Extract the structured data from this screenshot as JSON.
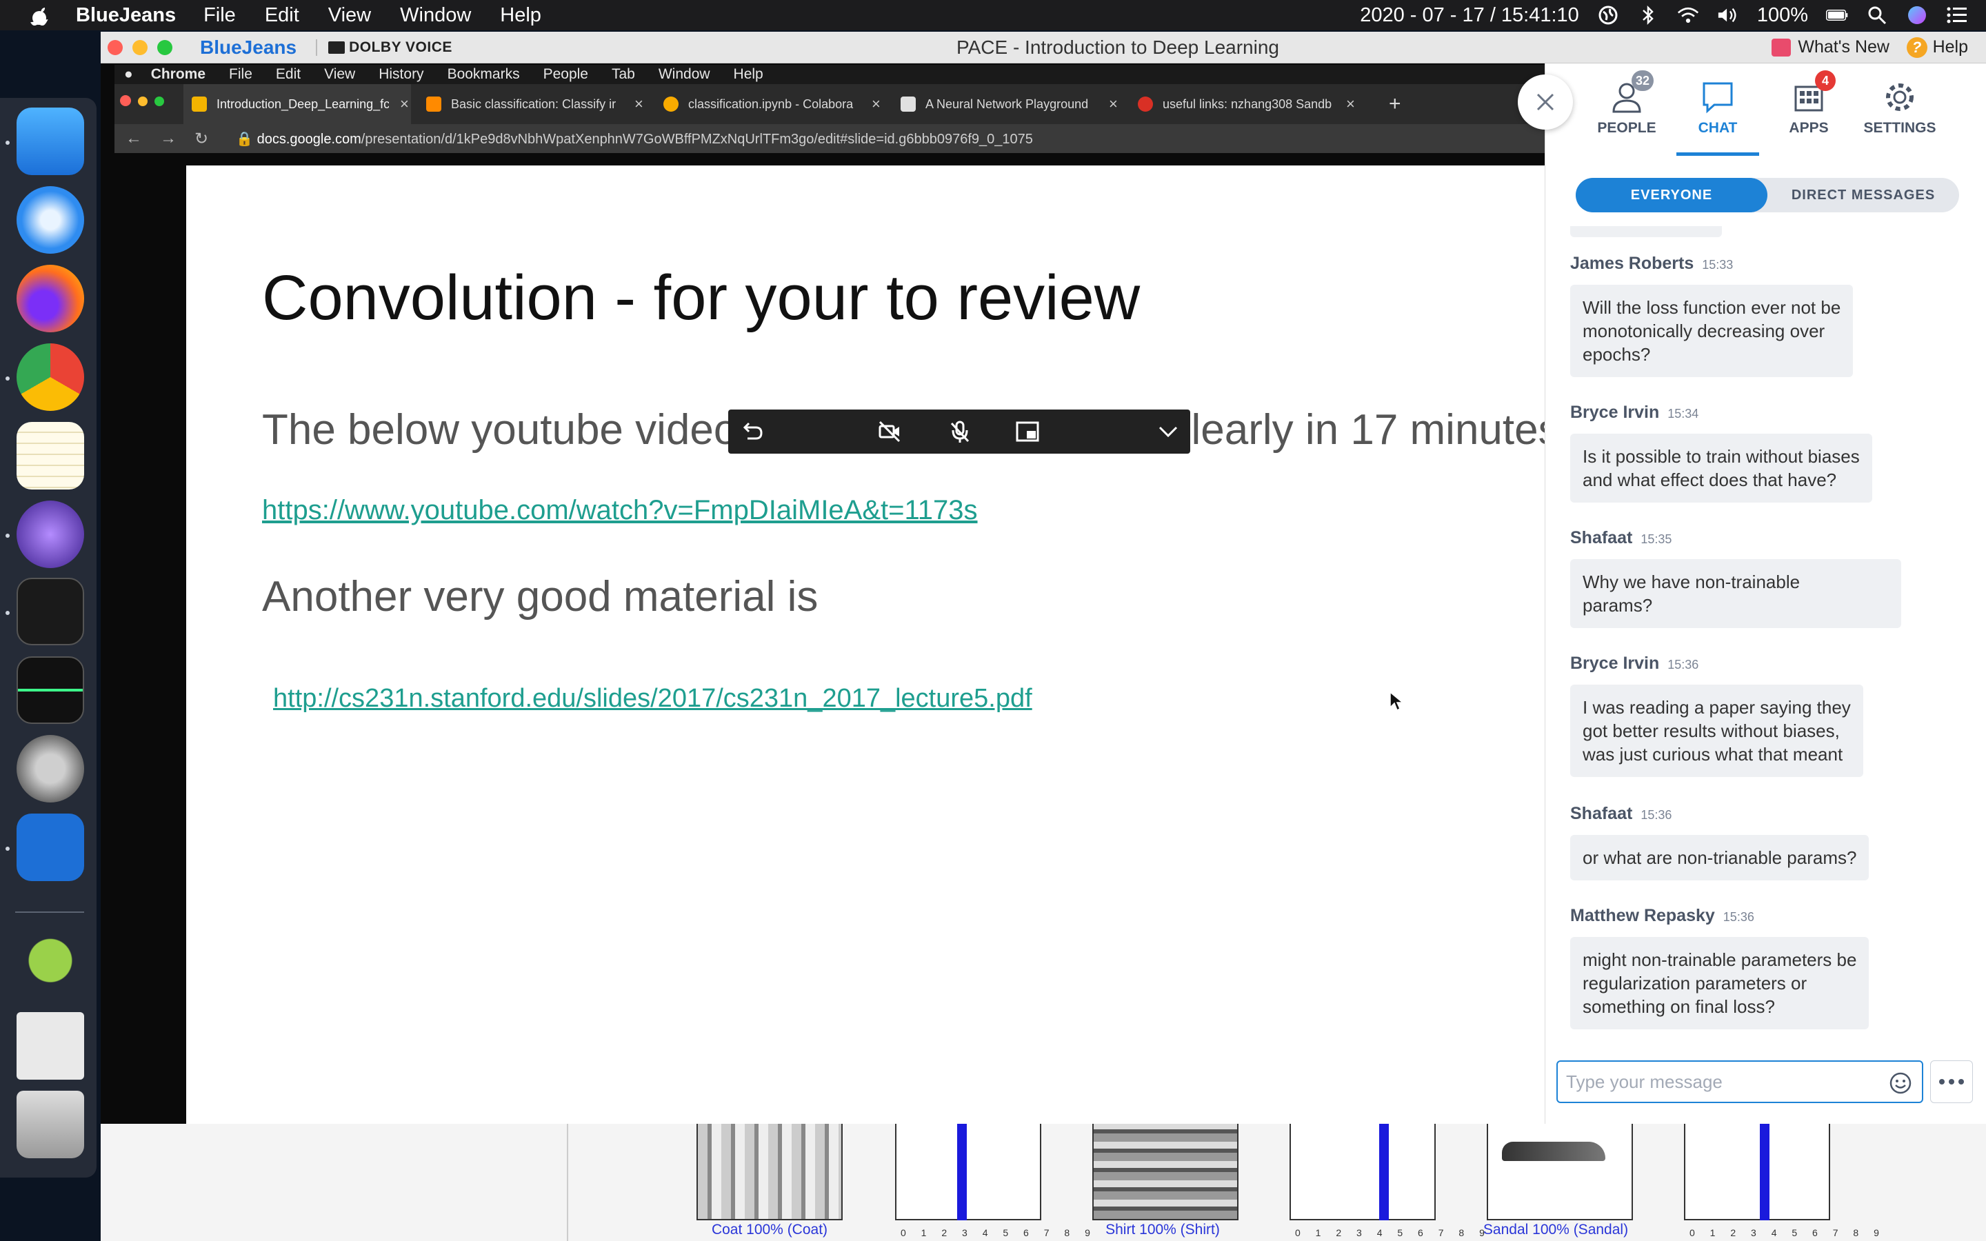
{
  "menubar": {
    "app_name": "BlueJeans",
    "menus": [
      "File",
      "Edit",
      "View",
      "Window",
      "Help"
    ],
    "datetime": "2020 - 07 - 17 / 15:41:10",
    "battery": "100%"
  },
  "bluejeans": {
    "brand": "BlueJeans",
    "dolby": "DOLBY VOICE",
    "window_title": "PACE - Introduction to Deep Learning",
    "whats_new": "What's New",
    "help": "Help"
  },
  "remote": {
    "menus": [
      "Chrome",
      "File",
      "Edit",
      "View",
      "History",
      "Bookmarks",
      "People",
      "Tab",
      "Window",
      "Help"
    ],
    "tabs": [
      {
        "label": "Introduction_Deep_Learning_fc",
        "color": "#f4b400"
      },
      {
        "label": "Basic classification: Classify ir",
        "color": "#ff8a00"
      },
      {
        "label": "classification.ipynb - Colabora",
        "color": "#f9ab00"
      },
      {
        "label": "A Neural Network Playground",
        "color": "#e0e0e0"
      },
      {
        "label": "useful links: nzhang308 Sandb",
        "color": "#d93025"
      }
    ],
    "url_host": "docs.google.com",
    "url_path": "/presentation/d/1kPe9d8vNbhWpatXenphnW7GoWBffPMZxNqUrlTFm3go/edit#slide=id.g6bbb0976f9_0_1075"
  },
  "slide": {
    "title": "Convolution - for your to review",
    "line1": "The below youtube video which describe it very clearly in 17 minutes",
    "link1": "https://www.youtube.com/watch?v=FmpDIaiMIeA&t=1173s",
    "line2": "Another very good material is",
    "link2": "http://cs231n.stanford.edu/slides/2017/cs231n_2017_lecture5.pdf"
  },
  "panel": {
    "tabs": [
      {
        "label": "PEOPLE",
        "badge": "32"
      },
      {
        "label": "CHAT",
        "badge": ""
      },
      {
        "label": "APPS",
        "badge": "4"
      },
      {
        "label": "SETTINGS",
        "badge": ""
      }
    ],
    "segments": [
      "EVERYONE",
      "DIRECT MESSAGES"
    ],
    "messages": [
      {
        "author": "James Roberts",
        "time": "15:33",
        "lines": [
          "Will the loss function ever not be",
          "monotonically decreasing over",
          "epochs?"
        ]
      },
      {
        "author": "Bryce Irvin",
        "time": "15:34",
        "lines": [
          "Is it possible to train without biases",
          "and what effect does that have?"
        ]
      },
      {
        "author": "Shafaat",
        "time": "15:35",
        "lines": [
          "Why we have non-trainable",
          "params?"
        ]
      },
      {
        "author": "Bryce Irvin",
        "time": "15:36",
        "lines": [
          "I was reading a paper saying they",
          "got better results without biases,",
          "was just curious what that meant"
        ]
      },
      {
        "author": "Shafaat",
        "time": "15:36",
        "lines": [
          "or what are non-trianable params?"
        ]
      },
      {
        "author": "Matthew Repasky",
        "time": "15:36",
        "lines": [
          "might non-trainable parameters be",
          "regularization parameters or",
          "something on final loss?"
        ]
      }
    ],
    "composer_placeholder": "Type your message"
  },
  "background": {
    "captions": [
      "Coat 100% (Coat)",
      "Shirt 100% (Shirt)",
      "Sandal 100% (Sandal)"
    ],
    "ticks": "0 1 2 3 4 5 6 7 8 9"
  },
  "colors": {
    "accent": "#1d82d6",
    "link": "#1e9e8f",
    "people_badge": "#8a93a3",
    "apps_badge": "#e53935"
  }
}
